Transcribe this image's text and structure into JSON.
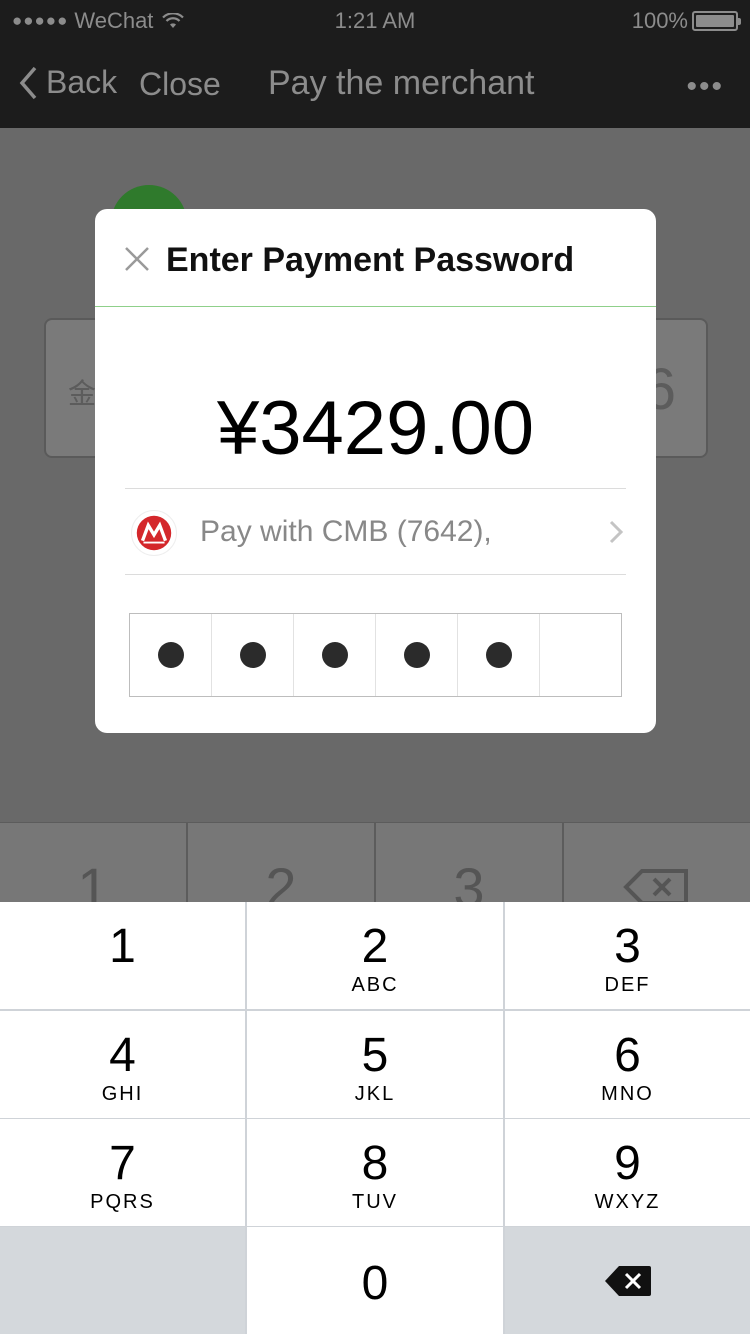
{
  "status_bar": {
    "carrier": "WeChat",
    "time": "1:21 AM",
    "battery": "100%"
  },
  "nav": {
    "back_label": "Back",
    "close_label": "Close",
    "title": "Pay the merchant",
    "more_label": "•••"
  },
  "background": {
    "amount_field_label": "金",
    "amount_field_value": "6",
    "keys": [
      "1",
      "2",
      "3",
      ""
    ]
  },
  "modal": {
    "title": "Enter Payment Password",
    "amount": "¥3429.00",
    "payment_method": "Pay with CMB (7642),",
    "password_digits_entered": 5,
    "password_length": 6,
    "colors": {
      "accent_line": "#8fd08a",
      "bank_logo": "#d4272b"
    }
  },
  "keypad": {
    "keys": [
      {
        "num": "1",
        "letters": ""
      },
      {
        "num": "2",
        "letters": "ABC"
      },
      {
        "num": "3",
        "letters": "DEF"
      },
      {
        "num": "4",
        "letters": "GHI"
      },
      {
        "num": "5",
        "letters": "JKL"
      },
      {
        "num": "6",
        "letters": "MNO"
      },
      {
        "num": "7",
        "letters": "PQRS"
      },
      {
        "num": "8",
        "letters": "TUV"
      },
      {
        "num": "9",
        "letters": "WXYZ"
      },
      {
        "num": "0",
        "letters": ""
      }
    ]
  }
}
